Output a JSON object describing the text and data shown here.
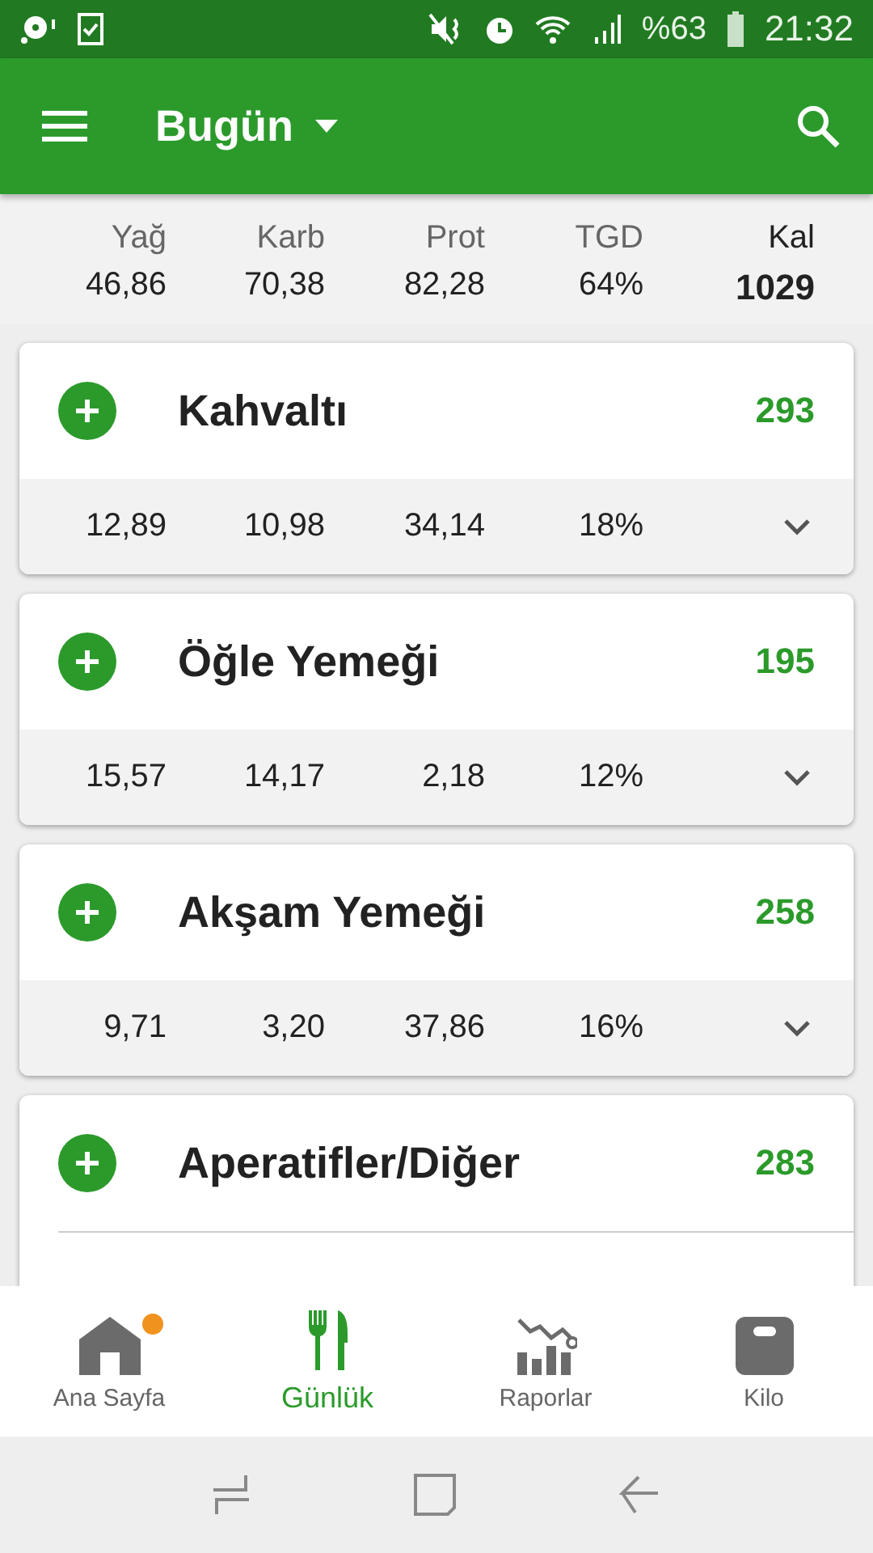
{
  "status_bar": {
    "battery": "%63",
    "time": "21:32"
  },
  "app_bar": {
    "title": "Bugün"
  },
  "summary": {
    "columns": [
      {
        "label": "Yağ",
        "value": "46,86"
      },
      {
        "label": "Karb",
        "value": "70,38"
      },
      {
        "label": "Prot",
        "value": "82,28"
      },
      {
        "label": "TGD",
        "value": "64%"
      }
    ],
    "total": {
      "label": "Kal",
      "value": "1029"
    }
  },
  "meals": [
    {
      "name": "Kahvaltı",
      "calories": "293",
      "expanded": false,
      "stats": [
        "12,89",
        "10,98",
        "34,14",
        "18%"
      ]
    },
    {
      "name": "Öğle Yemeği",
      "calories": "195",
      "expanded": false,
      "stats": [
        "15,57",
        "14,17",
        "2,18",
        "12%"
      ]
    },
    {
      "name": "Akşam Yemeği",
      "calories": "258",
      "expanded": false,
      "stats": [
        "9,71",
        "3,20",
        "37,86",
        "16%"
      ]
    },
    {
      "name": "Aperatifler/Diğer",
      "calories": "283"
    }
  ],
  "bottom_nav": [
    {
      "kind": "home",
      "label": "Ana Sayfa",
      "selected": false,
      "badge": true
    },
    {
      "kind": "diary",
      "label": "Günlük",
      "selected": true,
      "badge": false
    },
    {
      "kind": "reports",
      "label": "Raporlar",
      "selected": false,
      "badge": false
    },
    {
      "kind": "weight",
      "label": "Kilo",
      "selected": false,
      "badge": false
    }
  ]
}
